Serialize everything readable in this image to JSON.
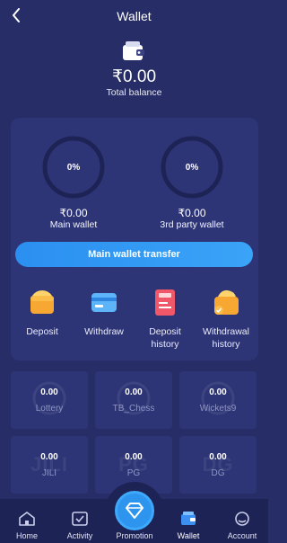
{
  "header": {
    "title": "Wallet",
    "back_icon": "chevron-left-icon"
  },
  "balance": {
    "amount": "₹0.00",
    "label": "Total balance",
    "icon": "wallet-icon"
  },
  "wallets": [
    {
      "percent_label": "0%",
      "percent_value": 0,
      "amount": "₹0.00",
      "label": "Main wallet"
    },
    {
      "percent_label": "0%",
      "percent_value": 0,
      "amount": "₹0.00",
      "label": "3rd party wallet"
    }
  ],
  "transfer_button": "Main wallet transfer",
  "actions": [
    {
      "label": "Deposit",
      "icon": "deposit-icon"
    },
    {
      "label": "Withdraw",
      "icon": "withdraw-card-icon"
    },
    {
      "label": "Deposit\nhistory",
      "icon": "deposit-history-icon"
    },
    {
      "label": "Withdrawal\nhistory",
      "icon": "withdrawal-history-icon"
    }
  ],
  "games": [
    {
      "amount": "0.00",
      "name": "Lottery",
      "watermark": ""
    },
    {
      "amount": "0.00",
      "name": "TB_Chess",
      "watermark": ""
    },
    {
      "amount": "0.00",
      "name": "Wickets9",
      "watermark": ""
    },
    {
      "amount": "0.00",
      "name": "JILI",
      "watermark": "JILI"
    },
    {
      "amount": "0.00",
      "name": "PG",
      "watermark": "PG"
    },
    {
      "amount": "0.00",
      "name": "DG",
      "watermark": "DG"
    }
  ],
  "nav": [
    {
      "label": "Home",
      "icon": "home-icon",
      "active": false
    },
    {
      "label": "Activity",
      "icon": "activity-icon",
      "active": false
    },
    {
      "label": "Promotion",
      "icon": "diamond-icon",
      "active": false
    },
    {
      "label": "Wallet",
      "icon": "wallet-icon",
      "active": true
    },
    {
      "label": "Account",
      "icon": "account-icon",
      "active": false
    }
  ],
  "colors": {
    "background": "#272d66",
    "panel": "#2e3576",
    "accent": "#2d95ee",
    "ring": "#1e2356",
    "nav_background": "#1e2356"
  }
}
